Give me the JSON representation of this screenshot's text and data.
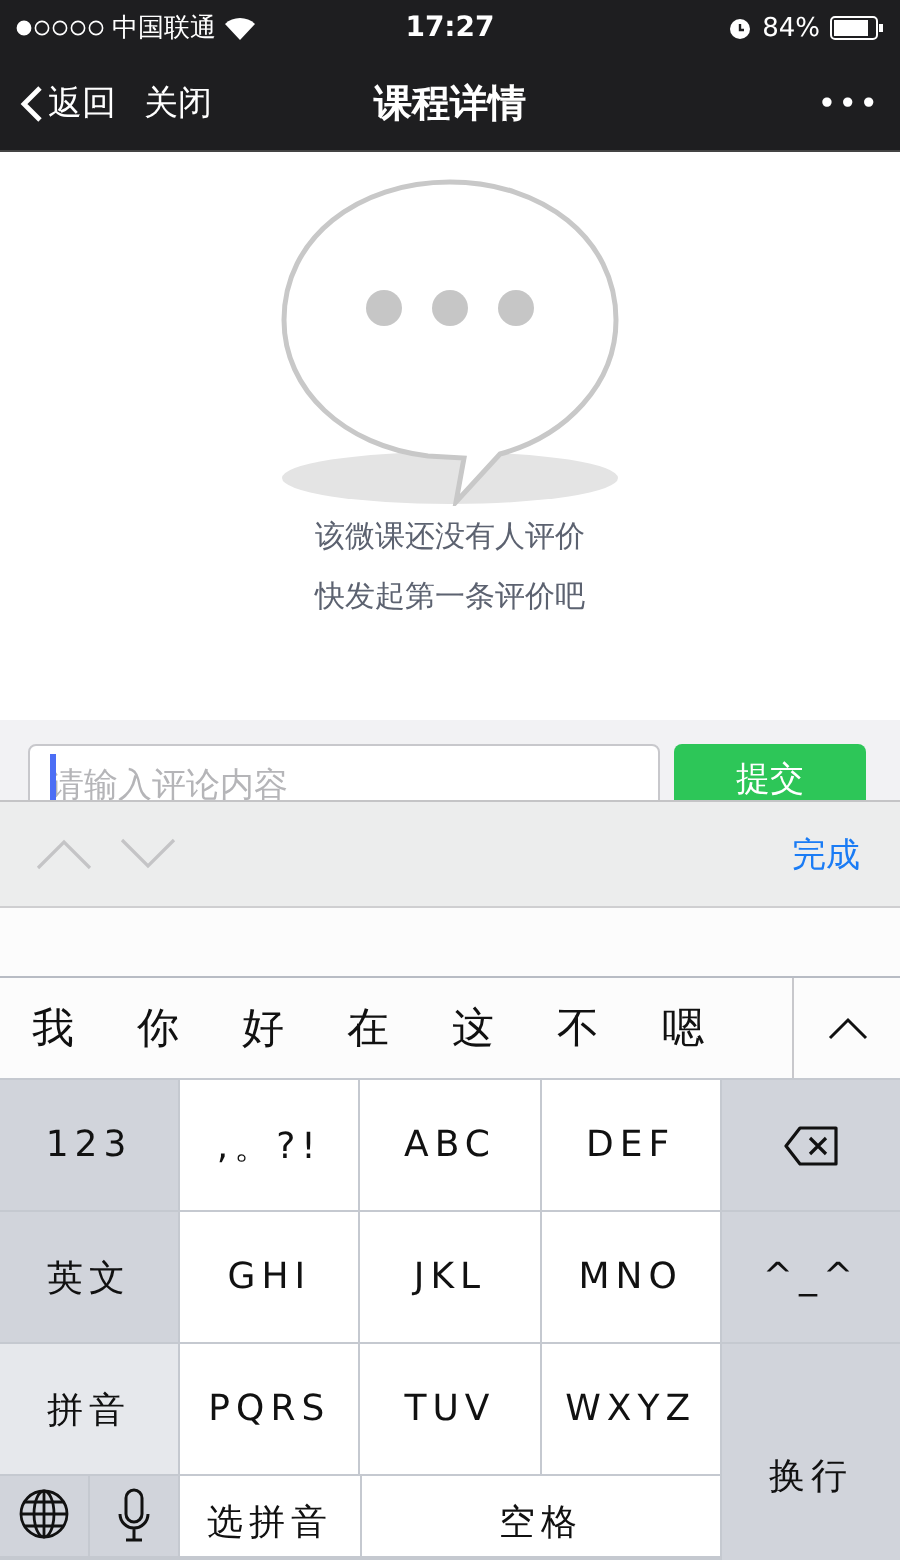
{
  "status_bar": {
    "carrier": "中国联通",
    "time": "17:27",
    "battery_text": "84%"
  },
  "nav": {
    "back": "返回",
    "close": "关闭",
    "title": "课程详情",
    "more": "•••"
  },
  "empty_state": {
    "lines": [
      "该微课还没有人评价",
      "快发起第一条评价吧"
    ]
  },
  "comment_bar": {
    "placeholder": "请输入评论内容",
    "submit": "提交"
  },
  "keyboard_toolbar": {
    "prev_disabled": true,
    "next_disabled": true,
    "done": "完成"
  },
  "candidates": [
    "我",
    "你",
    "好",
    "在",
    "这",
    "不",
    "嗯"
  ],
  "keyboard": {
    "left": [
      {
        "kind": "function",
        "label": "123"
      },
      {
        "kind": "function",
        "label": "英文"
      },
      {
        "kind": "current",
        "label": "拼音"
      }
    ],
    "left_bottom": [
      {
        "kind": "globe"
      },
      {
        "kind": "mic"
      }
    ],
    "center": [
      [
        {
          "kind": "char",
          "label": ",。?!"
        },
        {
          "kind": "char",
          "label": "ABC"
        },
        {
          "kind": "char",
          "label": "DEF"
        }
      ],
      [
        {
          "kind": "char",
          "label": "GHI"
        },
        {
          "kind": "char",
          "label": "JKL"
        },
        {
          "kind": "char",
          "label": "MNO"
        }
      ],
      [
        {
          "kind": "char",
          "label": "PQRS"
        },
        {
          "kind": "char",
          "label": "TUV"
        },
        {
          "kind": "char",
          "label": "WXYZ"
        }
      ],
      [
        {
          "kind": "char",
          "label": "选拼音"
        },
        {
          "kind": "char",
          "label": "空格"
        }
      ]
    ],
    "right": [
      {
        "kind": "delete"
      },
      {
        "kind": "function",
        "label": "^_^"
      },
      {
        "kind": "function",
        "label": "换行"
      }
    ]
  }
}
